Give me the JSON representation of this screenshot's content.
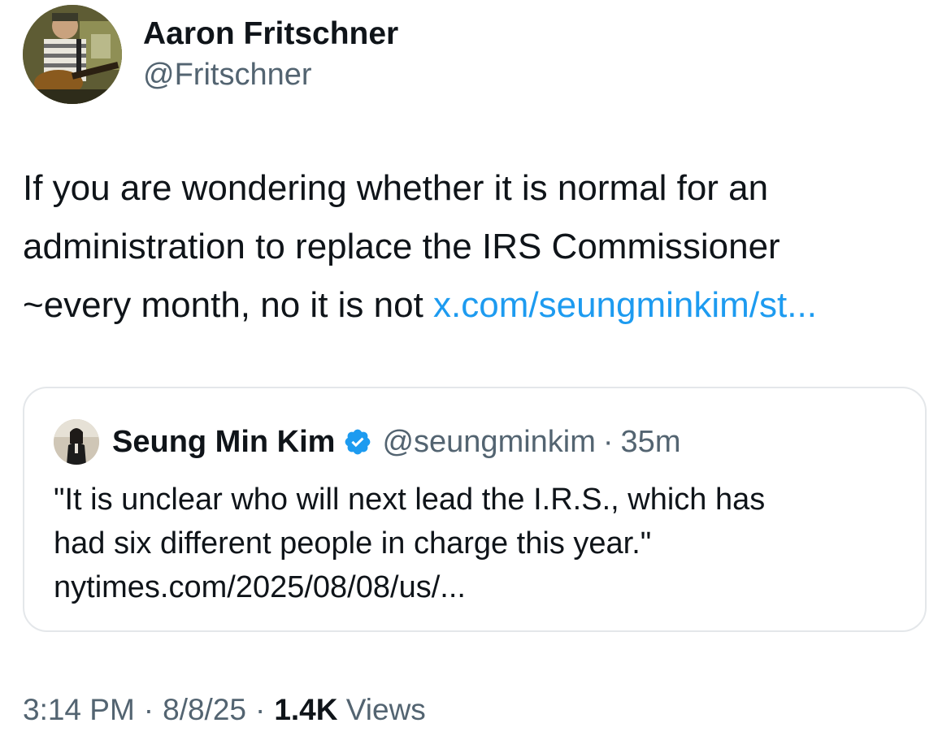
{
  "tweet": {
    "author_name": "Aaron Fritschner",
    "author_handle": "@Fritschner",
    "text_line_1": "If you are wondering whether it is normal for an",
    "text_line_2": "administration to replace the IRS Commissioner",
    "text_line_3": "~every month, no it is not ",
    "link_text": "x.com/seungminkim/st...",
    "link_color": "#1d9bf0"
  },
  "quoted_tweet": {
    "author_name": "Seung Min Kim",
    "verified": true,
    "verified_icon": "verified-badge-icon",
    "author_handle": "@seungminkim",
    "separator": "·",
    "time_ago": "35m",
    "text_line_1": "\"It is unclear who will next lead the I.R.S., which has",
    "text_line_2": "had six different people in charge this year.\"",
    "text_line_3": "nytimes.com/2025/08/08/us/..."
  },
  "meta": {
    "time": "3:14 PM",
    "separator": "·",
    "date": "8/8/25",
    "views_count": "1.4K",
    "views_label": "Views"
  },
  "colors": {
    "text_primary": "#0f1419",
    "text_secondary": "#536471",
    "link": "#1d9bf0",
    "verified": "#1d9bf0",
    "border": "#e4e7ea"
  }
}
